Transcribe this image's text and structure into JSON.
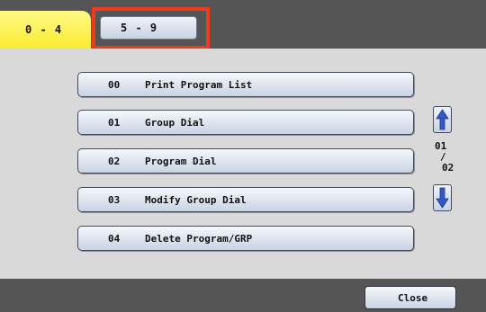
{
  "tabs": [
    {
      "label": "0 - 4",
      "active": true
    },
    {
      "label": "5 - 9",
      "active": false
    }
  ],
  "programs": [
    {
      "number": "00",
      "label": "Print Program List"
    },
    {
      "number": "01",
      "label": "Group Dial"
    },
    {
      "number": "02",
      "label": "Program Dial"
    },
    {
      "number": "03",
      "label": "Modify Group Dial"
    },
    {
      "number": "04",
      "label": "Delete Program/GRP"
    }
  ],
  "pager": {
    "current": "01",
    "separator": "/",
    "total": "02",
    "up_icon": "arrow-up-icon",
    "down_icon": "arrow-down-icon"
  },
  "footer": {
    "close_label": "Close"
  },
  "colors": {
    "bar": "#555555",
    "active_tab": "#fbeb2e",
    "highlight": "#ef3b1d",
    "arrow": "#2f59c8"
  }
}
